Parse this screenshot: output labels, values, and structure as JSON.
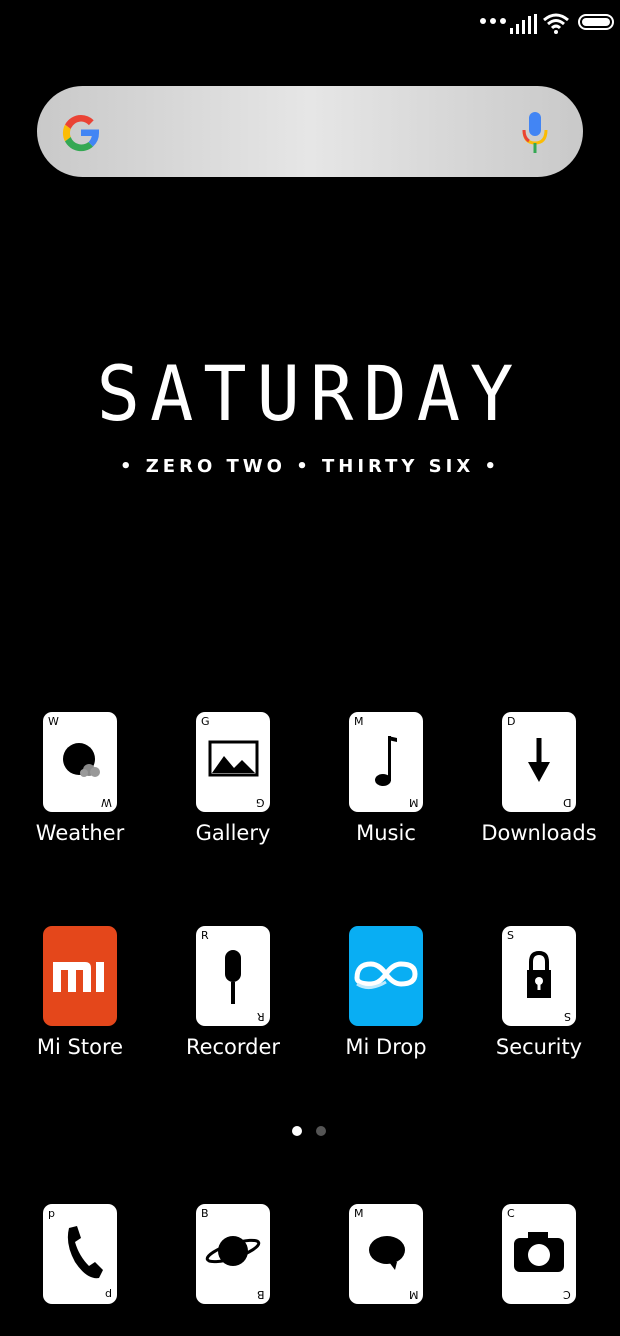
{
  "status_bar": {
    "icons": [
      "more-dots-icon",
      "signal-icon",
      "wifi-icon",
      "battery-icon"
    ]
  },
  "search": {
    "logo": "google-g-icon",
    "voice": "mic-icon"
  },
  "clock_widget": {
    "day": "SATURDAY",
    "time_words": "• ZERO TWO • THIRTY SIX •"
  },
  "apps": [
    {
      "label": "Weather",
      "letter": "W",
      "icon": "weather-icon"
    },
    {
      "label": "Gallery",
      "letter": "G",
      "icon": "image-icon"
    },
    {
      "label": "Music",
      "letter": "M",
      "icon": "music-note-icon"
    },
    {
      "label": "Downloads",
      "letter": "D",
      "icon": "download-arrow-icon"
    },
    {
      "label": "Mi Store",
      "letter": "",
      "icon": "mi-logo-icon"
    },
    {
      "label": "Recorder",
      "letter": "R",
      "icon": "microphone-icon"
    },
    {
      "label": "Mi Drop",
      "letter": "",
      "icon": "infinity-icon"
    },
    {
      "label": "Security",
      "letter": "S",
      "icon": "lock-icon"
    }
  ],
  "dock": [
    {
      "letter": "P",
      "icon": "phone-icon"
    },
    {
      "letter": "B",
      "icon": "planet-icon"
    },
    {
      "letter": "M",
      "icon": "chat-bubble-icon"
    },
    {
      "letter": "C",
      "icon": "camera-icon"
    }
  ],
  "pager": {
    "pages": 2,
    "current": 1
  },
  "colors": {
    "mi_store": "#e4471b",
    "mi_drop": "#09aef3",
    "background": "#000000"
  }
}
